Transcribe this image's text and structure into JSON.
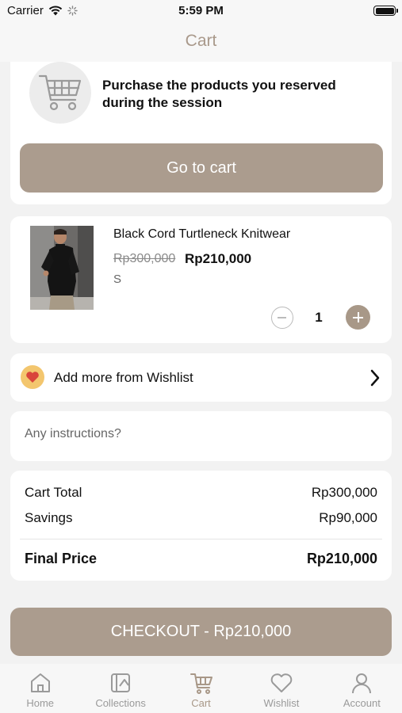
{
  "status_bar": {
    "carrier": "Carrier",
    "time": "5:59 PM"
  },
  "header": {
    "title": "Cart"
  },
  "reserve": {
    "message": "Purchase the products you reserved during the session",
    "button_label": "Go to cart"
  },
  "cart_item": {
    "name": "Black Cord Turtleneck Knitwear",
    "original_price": "Rp300,000",
    "price": "Rp210,000",
    "size": "S",
    "quantity": "1"
  },
  "wishlist": {
    "label": "Add more from Wishlist"
  },
  "instructions": {
    "placeholder": "Any instructions?"
  },
  "summary": {
    "cart_total_label": "Cart Total",
    "cart_total_value": "Rp300,000",
    "savings_label": "Savings",
    "savings_value": "Rp90,000",
    "final_label": "Final Price",
    "final_value": "Rp210,000"
  },
  "checkout": {
    "label": "CHECKOUT - Rp210,000"
  },
  "tabs": [
    {
      "label": "Home",
      "icon": "home-icon"
    },
    {
      "label": "Collections",
      "icon": "collections-icon"
    },
    {
      "label": "Cart",
      "icon": "cart-icon"
    },
    {
      "label": "Wishlist",
      "icon": "heart-icon"
    },
    {
      "label": "Account",
      "icon": "person-icon"
    }
  ],
  "colors": {
    "accent": "#ab9c8e",
    "title": "#a9998b",
    "badge": "#f3c66e"
  }
}
